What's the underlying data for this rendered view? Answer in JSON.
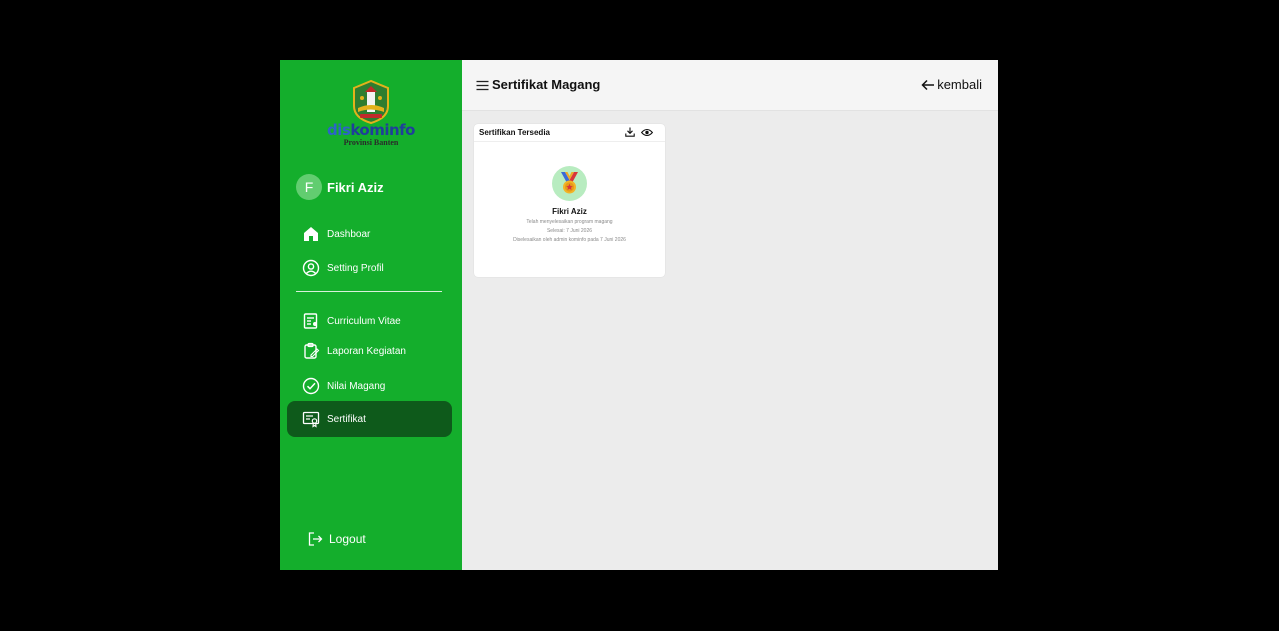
{
  "logo": {
    "brand_light": "dis",
    "brand_dark": "kominfo",
    "subtitle": "Provinsi Banten"
  },
  "user": {
    "initial": "F",
    "name": "Fikri Aziz"
  },
  "sidebar": {
    "items": [
      {
        "label": "Dashboar",
        "icon": "home-icon"
      },
      {
        "label": "Setting Profil",
        "icon": "user-circle-icon"
      },
      {
        "label": "Curriculum Vitae",
        "icon": "document-icon"
      },
      {
        "label": "Laporan Kegiatan",
        "icon": "clipboard-icon"
      },
      {
        "label": "Nilai Magang",
        "icon": "check-circle-icon"
      },
      {
        "label": "Sertifikat",
        "icon": "certificate-icon",
        "active": true
      }
    ],
    "logout_label": "Logout"
  },
  "header": {
    "title": "Sertifikat Magang",
    "back_label": "kembali"
  },
  "card": {
    "title": "Sertifikan Tersedia",
    "name": "Fikri Aziz",
    "line1": "Telah menyelesaikan program magang",
    "line2": "Selesai: 7 Juni 2026",
    "line3": "Diselesaikan oleh admin kominfo pada 7 Juni 2026"
  },
  "colors": {
    "sidebar": "#14ae2c",
    "active_item": "#0e5a1b",
    "avatar": "#62cd70",
    "medal_bg": "#b8ecc0"
  }
}
